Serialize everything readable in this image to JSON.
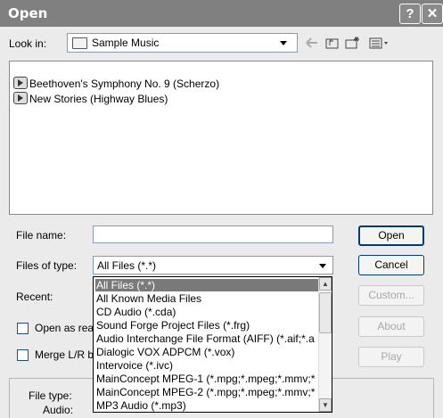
{
  "window": {
    "title": "Open",
    "help_glyph": "?",
    "close_glyph": "✕"
  },
  "lookin": {
    "label": "Look in:",
    "value": "Sample Music"
  },
  "toolbar_icons": [
    "back-arrow-icon",
    "up-folder-icon",
    "new-folder-icon",
    "view-menu-icon"
  ],
  "files": [
    "Beethoven's Symphony No. 9 (Scherzo)",
    "New Stories (Highway Blues)"
  ],
  "filename": {
    "label": "File name:",
    "value": ""
  },
  "filetype": {
    "label": "Files of type:",
    "value": "All Files (*.*)",
    "options": [
      "All Files (*.*)",
      "All Known Media Files",
      "CD Audio (*.cda)",
      "Sound Forge Project Files (*.frg)",
      "Audio Interchange File Format (AIFF) (*.aif;*.a",
      "Dialogic VOX ADPCM (*.vox)",
      "Intervoice (*.ivc)",
      "MainConcept MPEG-1 (*.mpg;*.mpeg;*.mmv;*",
      "MainConcept MPEG-2 (*.mpg;*.mpeg;*.mmv;*",
      "MP3 Audio (*.mp3)"
    ]
  },
  "recent": {
    "label": "Recent:"
  },
  "checkboxes": {
    "open_as": "Open as rea",
    "merge": "Merge L/R b"
  },
  "buttons": {
    "open": "Open",
    "cancel": "Cancel",
    "custom": "Custom...",
    "about": "About",
    "play": "Play"
  },
  "info": {
    "filetype_label": "File type:",
    "audio_label": "Audio:"
  }
}
